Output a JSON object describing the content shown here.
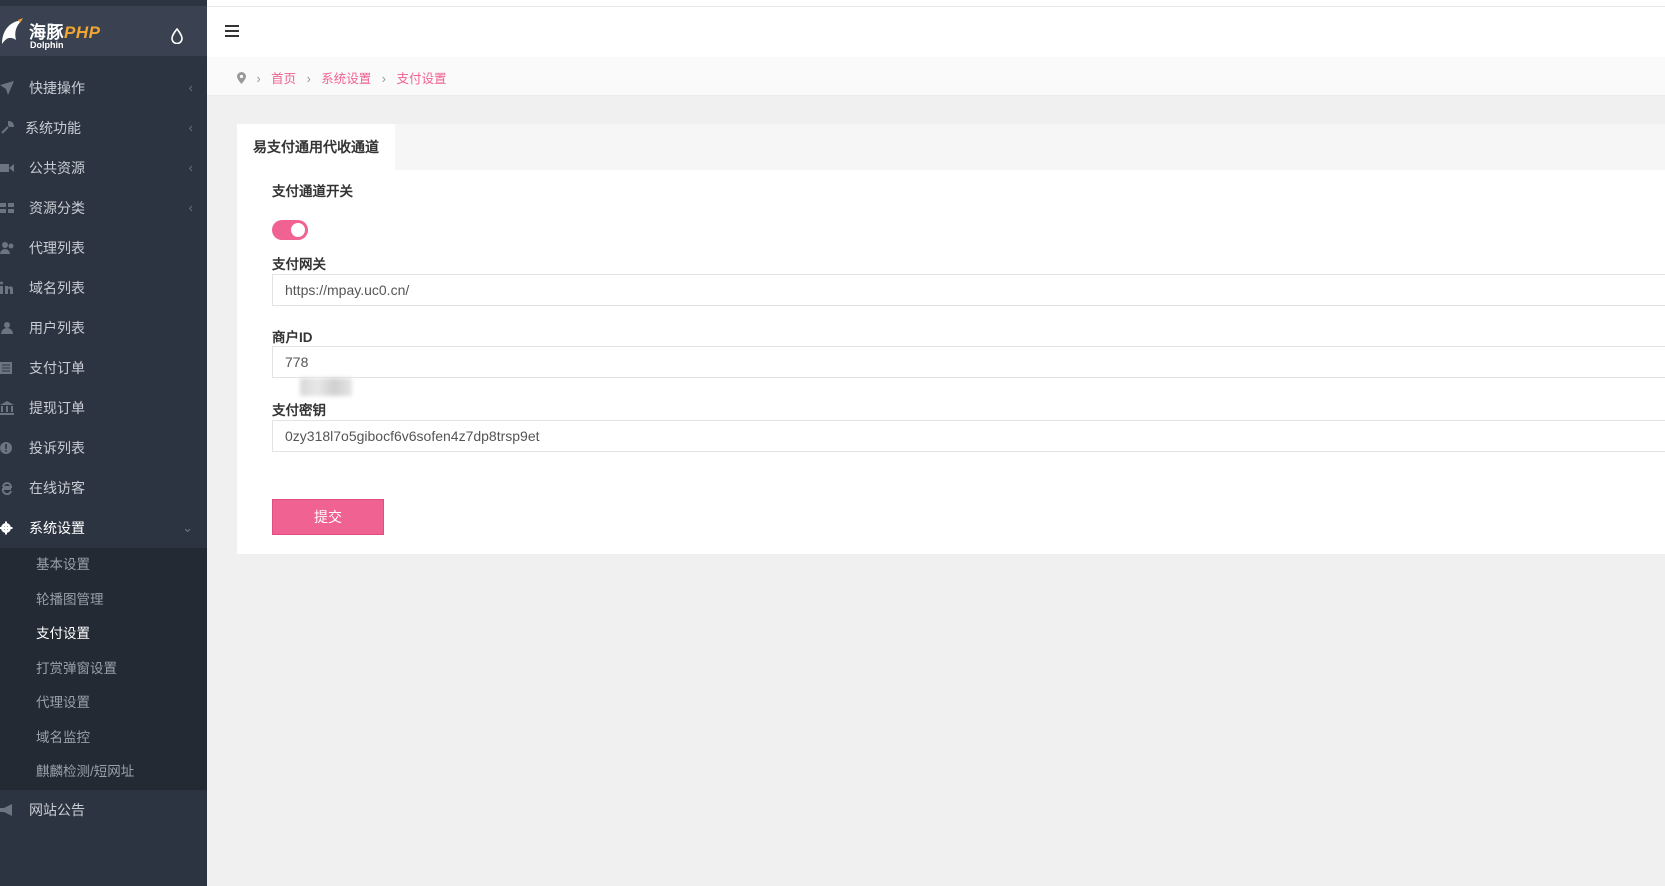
{
  "brand": {
    "name": "海豚",
    "suffix": "PHP",
    "sub": "Dolphin"
  },
  "icons": {
    "logo": "dolphin-logo-icon",
    "theme": "droplet-icon",
    "menu_toggle": "hamburger-icon",
    "breadcrumb_home": "map-marker-icon"
  },
  "sidebar": {
    "items": [
      {
        "label": "快捷操作",
        "icon": "send-icon",
        "arrow": "‹"
      },
      {
        "label": "系统功能",
        "icon": "wrench-icon",
        "arrow": "‹"
      },
      {
        "label": "公共资源",
        "icon": "video-camera-icon",
        "arrow": "‹"
      },
      {
        "label": "资源分类",
        "icon": "grid-icon",
        "arrow": "‹"
      },
      {
        "label": "代理列表",
        "icon": "users-icon",
        "arrow": ""
      },
      {
        "label": "域名列表",
        "icon": "linkedin-icon",
        "arrow": ""
      },
      {
        "label": "用户列表",
        "icon": "user-icon",
        "arrow": ""
      },
      {
        "label": "支付订单",
        "icon": "list-icon",
        "arrow": ""
      },
      {
        "label": "提现订单",
        "icon": "bank-icon",
        "arrow": ""
      },
      {
        "label": "投诉列表",
        "icon": "info-circle-icon",
        "arrow": ""
      },
      {
        "label": "在线访客",
        "icon": "ie-browser-icon",
        "arrow": ""
      },
      {
        "label": "系统设置",
        "icon": "gear-icon",
        "arrow": "⌄"
      }
    ],
    "submenu": [
      {
        "label": "基本设置"
      },
      {
        "label": "轮播图管理"
      },
      {
        "label": "支付设置"
      },
      {
        "label": "打赏弹窗设置"
      },
      {
        "label": "代理设置"
      },
      {
        "label": "域名监控"
      },
      {
        "label": "麒麟检测/短网址"
      }
    ],
    "bottom": {
      "label": "网站公告",
      "icon": "bullhorn-icon"
    }
  },
  "breadcrumb": [
    {
      "label": "首页"
    },
    {
      "label": "系统设置"
    },
    {
      "label": "支付设置"
    }
  ],
  "breadcrumb_sep": "›",
  "card": {
    "tab": "易支付通用代收通道",
    "fields": {
      "switch_label": "支付通道开关",
      "switch_on": true,
      "gateway_label": "支付网关",
      "gateway_value": "https://mpay.uc0.cn/",
      "merchant_label": "商户ID",
      "merchant_value": "778",
      "secret_label": "支付密钥",
      "secret_value": "0zy318l7o5gibocf6v6sofen4z7dp8trsp9et"
    },
    "submit": "提交"
  },
  "colors": {
    "accent": "#f06292",
    "sidebar_bg": "#2d3441",
    "submenu_bg": "#232a34",
    "logo_bar_bg": "#3a4150"
  }
}
